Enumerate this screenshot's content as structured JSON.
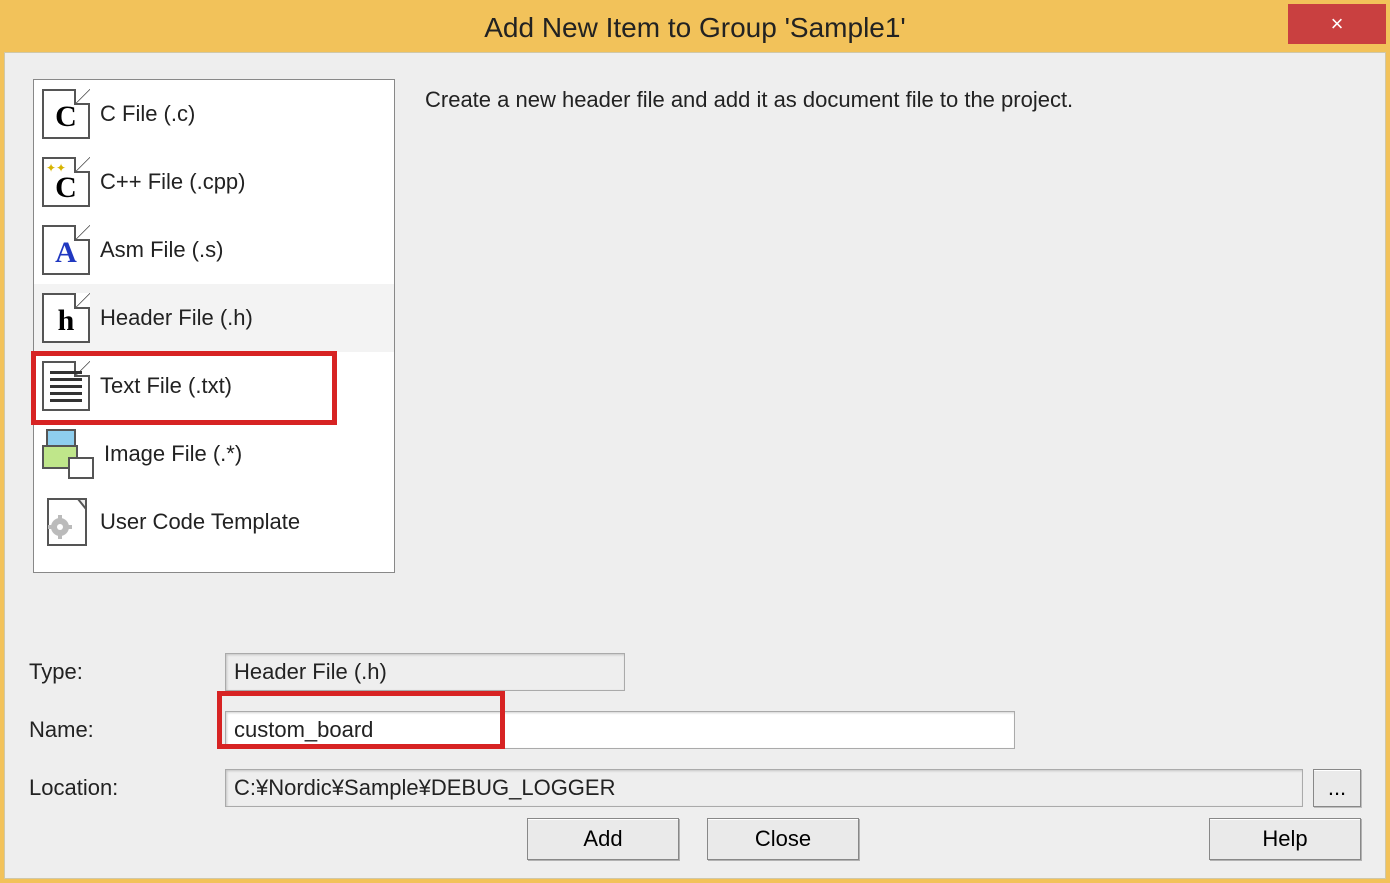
{
  "title": "Add New Item to Group 'Sample1'",
  "close_glyph": "×",
  "description": "Create a new header file and add it as document file to the project.",
  "items": [
    {
      "label": "C File (.c)"
    },
    {
      "label": "C++ File (.cpp)"
    },
    {
      "label": "Asm File (.s)"
    },
    {
      "label": "Header File (.h)"
    },
    {
      "label": "Text File (.txt)"
    },
    {
      "label": "Image File (.*)"
    },
    {
      "label": "User Code Template"
    }
  ],
  "form": {
    "type_label": "Type:",
    "type_value": "Header File (.h)",
    "name_label": "Name:",
    "name_value": "custom_board",
    "location_label": "Location:",
    "location_value": "C:¥Nordic¥Sample¥DEBUG_LOGGER",
    "browse_label": "..."
  },
  "buttons": {
    "add": "Add",
    "close": "Close",
    "help": "Help"
  }
}
